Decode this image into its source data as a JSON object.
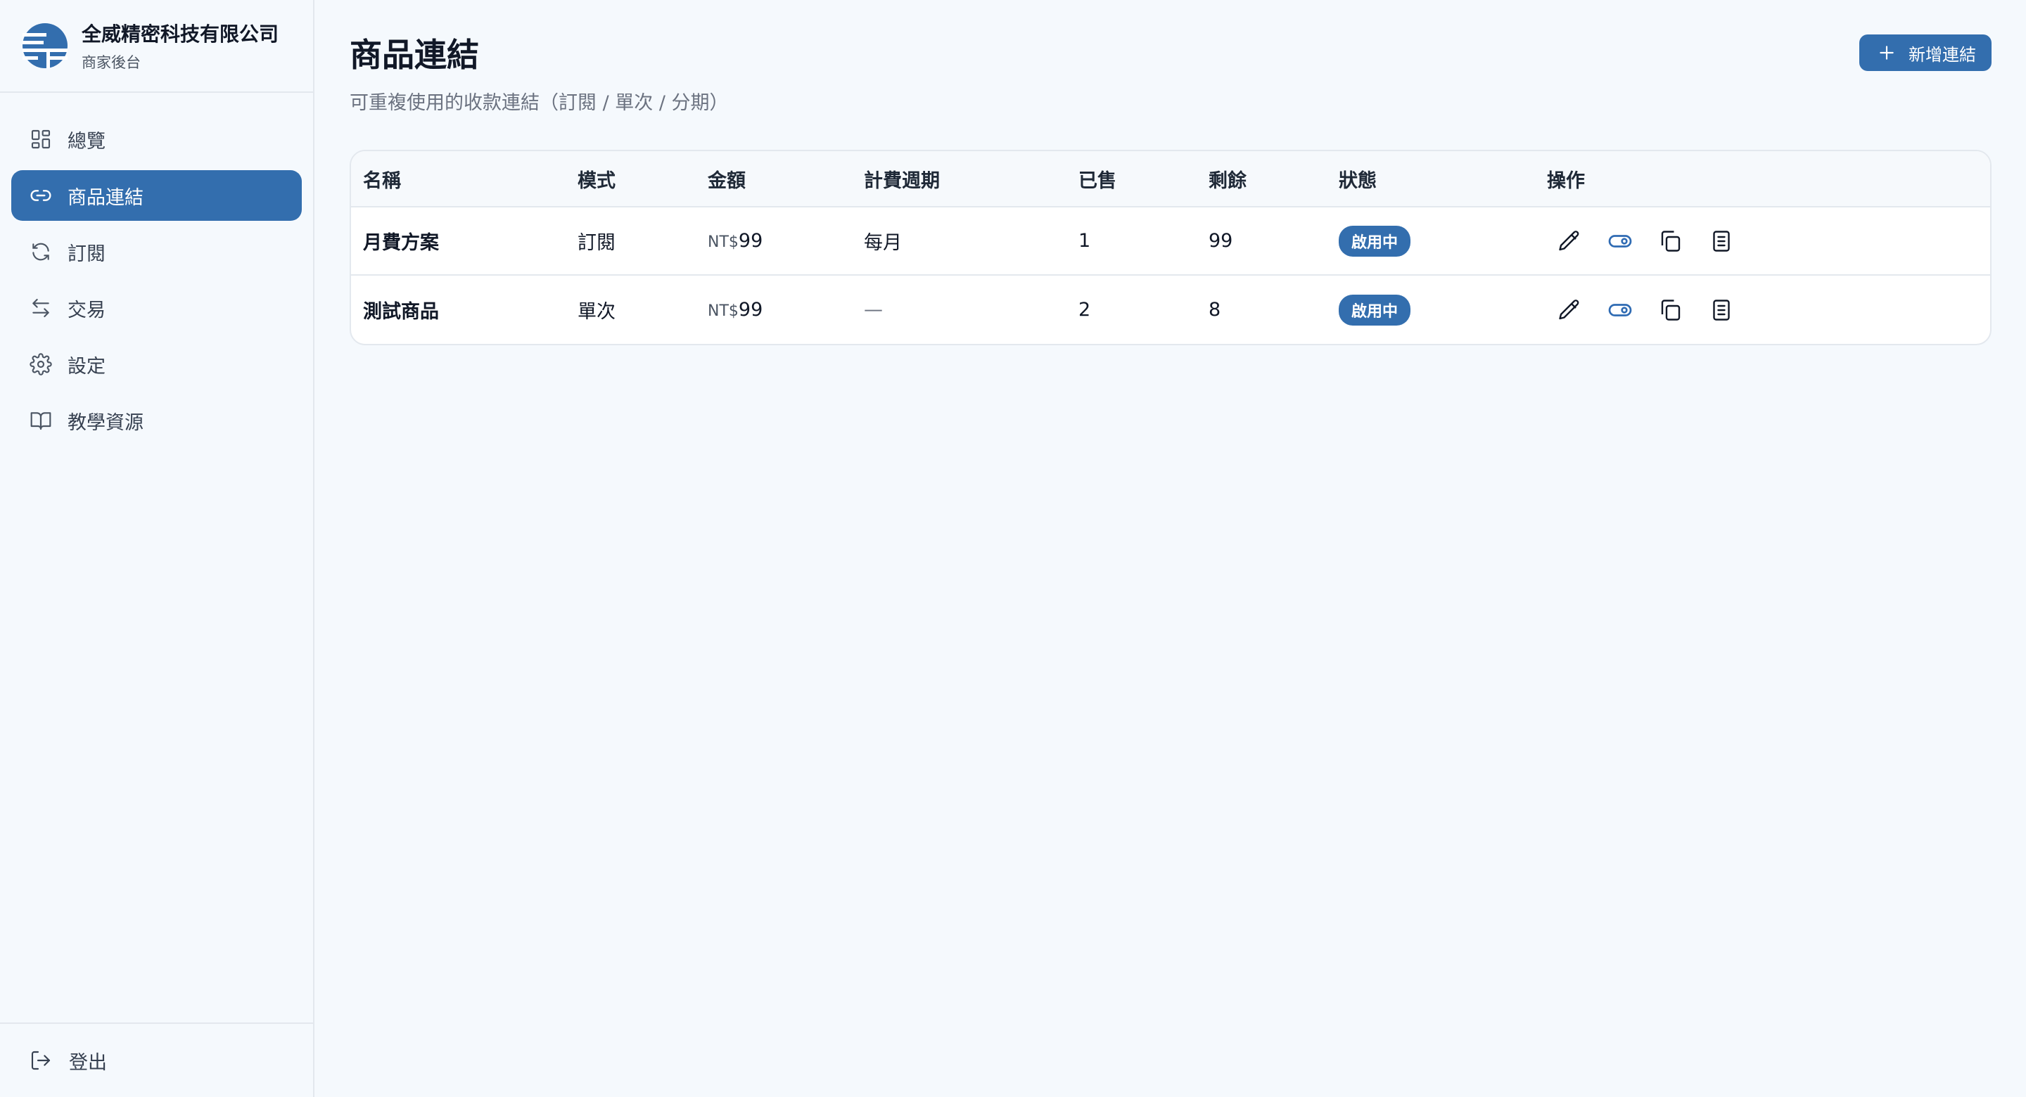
{
  "brand": {
    "name": "全威精密科技有限公司",
    "subtitle": "商家後台"
  },
  "nav": {
    "items": [
      {
        "label": "總覽",
        "icon": "grid-icon",
        "active": false
      },
      {
        "label": "商品連結",
        "icon": "link-icon",
        "active": true
      },
      {
        "label": "訂閱",
        "icon": "refresh-icon",
        "active": false
      },
      {
        "label": "交易",
        "icon": "swap-icon",
        "active": false
      },
      {
        "label": "設定",
        "icon": "gear-icon",
        "active": false
      },
      {
        "label": "教學資源",
        "icon": "book-icon",
        "active": false
      }
    ],
    "logout_label": "登出"
  },
  "page": {
    "title": "商品連結",
    "subtitle": "可重複使用的收款連結（訂閱 / 單次 / 分期）",
    "add_button_label": "新增連結"
  },
  "table": {
    "columns": [
      "名稱",
      "模式",
      "金額",
      "計費週期",
      "已售",
      "剩餘",
      "狀態",
      "操作"
    ],
    "rows": [
      {
        "name": "月費方案",
        "mode": "訂閱",
        "currency": "NT$",
        "amount": "99",
        "cycle": "每月",
        "sold": "1",
        "remaining": "99",
        "status": "啟用中"
      },
      {
        "name": "測試商品",
        "mode": "單次",
        "currency": "NT$",
        "amount": "99",
        "cycle": "—",
        "sold": "2",
        "remaining": "8",
        "status": "啟用中"
      }
    ]
  },
  "colors": {
    "accent": "#336eae",
    "toggle": "#2f6bb3"
  }
}
